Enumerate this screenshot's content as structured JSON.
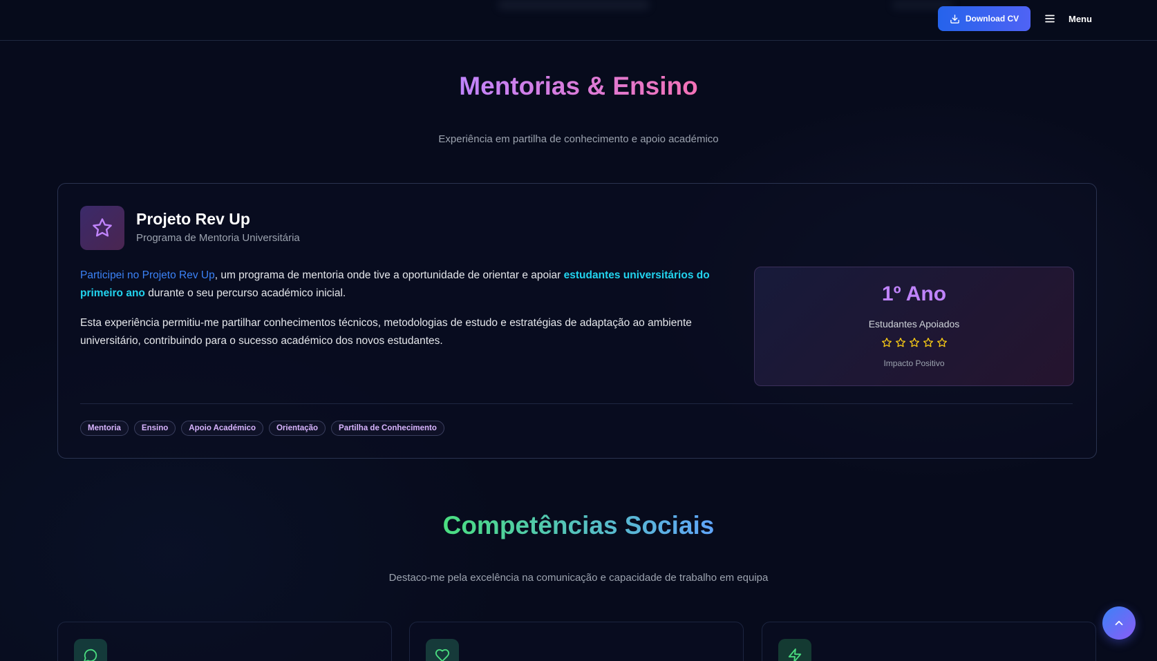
{
  "header": {
    "download_cv_label": "Download CV",
    "menu_label": "Menu"
  },
  "mentoring": {
    "title": "Mentorias & Ensino",
    "subtitle": "Experiência em partilha de conhecimento e apoio académico",
    "project": {
      "title": "Projeto Rev Up",
      "subtitle": "Programa de Mentoria Universitária",
      "p1_highlight1": "Participei no Projeto Rev Up",
      "p1_text1": ", um programa de mentoria onde tive a oportunidade de orientar e apoiar ",
      "p1_highlight2": "estudantes universitários do primeiro ano",
      "p1_text2": " durante o seu percurso académico inicial.",
      "p2": "Esta experiência permitiu-me partilhar conhecimentos técnicos, metodologias de estudo e estratégias de adaptação ao ambiente universitário, contribuindo para o sucesso académico dos novos estudantes.",
      "stat": {
        "value": "1º Ano",
        "label": "Estudantes Apoiados",
        "rating": 5,
        "footer": "Impacto Positivo"
      },
      "tags": [
        "Mentoria",
        "Ensino",
        "Apoio Académico",
        "Orientação",
        "Partilha de Conhecimento"
      ]
    }
  },
  "social": {
    "title": "Competências Sociais",
    "subtitle": "Destaco-me pela excelência na comunicação e capacidade de trabalho em equipa",
    "cards": [
      {
        "icon": "chat-bubble-icon"
      },
      {
        "icon": "heart-icon"
      },
      {
        "icon": "lightning-icon"
      }
    ]
  },
  "colors": {
    "accent_blue": "#2563eb",
    "accent_purple": "#c084fc",
    "accent_pink": "#f472b6",
    "accent_green": "#4ade80",
    "star_yellow": "#facc15"
  }
}
